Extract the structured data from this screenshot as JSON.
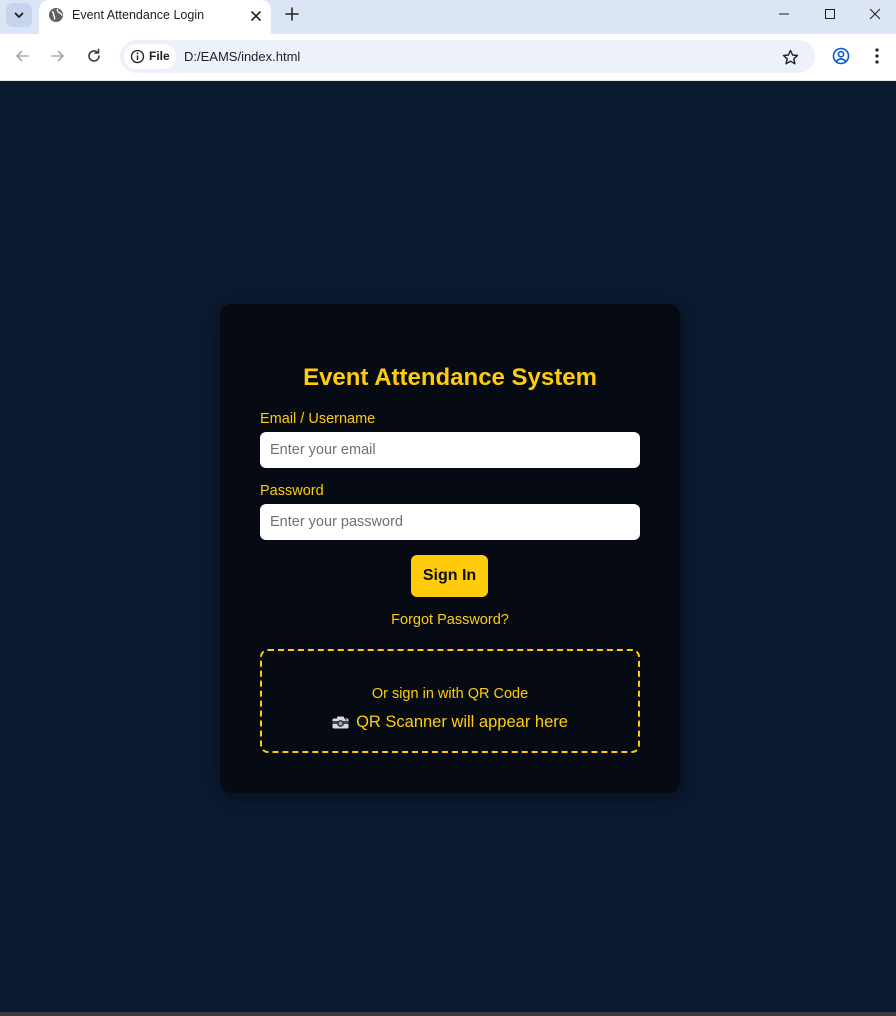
{
  "browser": {
    "tab": {
      "title": "Event Attendance Login",
      "favicon": "globe-icon"
    },
    "address": {
      "chip_label": "File",
      "url": "D:/EAMS/index.html"
    }
  },
  "page": {
    "title": "Event Attendance System",
    "email": {
      "label": "Email / Username",
      "placeholder": "Enter your email",
      "value": ""
    },
    "password": {
      "label": "Password",
      "placeholder": "Enter your password",
      "value": ""
    },
    "signin_label": "Sign In",
    "forgot_label": "Forgot Password?",
    "qr": {
      "label": "Or sign in with QR Code",
      "placeholder_text": "QR Scanner will appear here",
      "icon": "camera-icon"
    }
  },
  "colors": {
    "background": "#0b1931",
    "card": "#050a13",
    "accent": "#ffcc0b",
    "chrome_frame": "#dbe5f6"
  }
}
